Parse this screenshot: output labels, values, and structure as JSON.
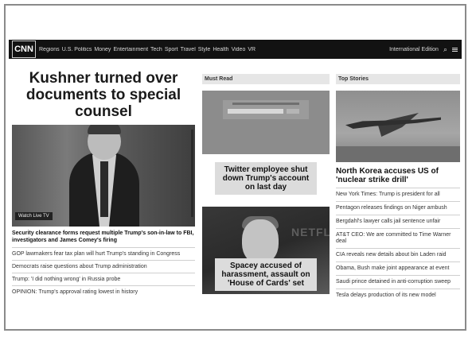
{
  "nav": {
    "logo": "CNN",
    "links": [
      "Regions",
      "U.S. Politics",
      "Money",
      "Entertainment",
      "Tech",
      "Sport",
      "Travel",
      "Style",
      "Health",
      "Video",
      "VR"
    ],
    "right_text": "International Edition"
  },
  "lead": {
    "headline": "Kushner turned over documents to special counsel",
    "badge": "Watch Live TV",
    "caption": "Security clearance forms request multiple Trump's son-in-law to FBI, investigators and James Comey's firing",
    "items": [
      "GOP lawmakers fear tax plan will hurt Trump's standing in Congress",
      "Democrats raise questions about Trump administration",
      "Trump: 'I did nothing wrong' in Russia probe",
      "OPINION: Trump's approval rating lowest in history"
    ]
  },
  "middle": {
    "section": "Must Read",
    "story1": "Twitter employee shut down Trump's account on last day",
    "story2": "Spacey accused of harassment, assault on 'House of Cards' set",
    "netflix": "NETFLIX"
  },
  "right": {
    "section": "Top Stories",
    "headline": "North Korea accuses US of 'nuclear strike drill'",
    "items": [
      "New York Times: Trump is president for all",
      "Pentagon releases findings on Niger ambush",
      "Bergdahl's lawyer calls jail sentence unfair",
      "AT&T CEO: We are committed to Time Warner deal",
      "CIA reveals new details about bin Laden raid",
      "Obama, Bush make joint appearance at event",
      "Saudi prince detained in anti-corruption sweep",
      "Tesla delays production of its new model"
    ]
  }
}
